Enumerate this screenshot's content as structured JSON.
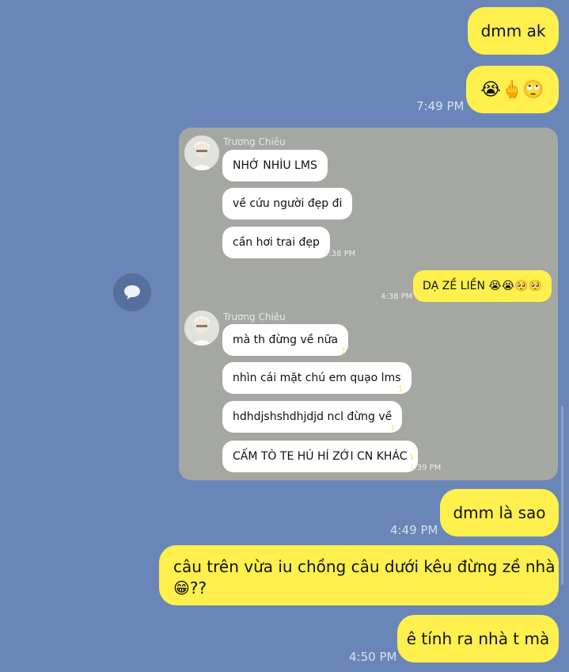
{
  "messages": {
    "m1": "dmm ak",
    "m2_emoji": "😭🖕🙄",
    "m2_time": "7:49 PM",
    "m3": "dmm là sao",
    "m3_time": "4:49 PM",
    "m4_line1": "câu trên vừa iu chồng câu dưới kêu đừng zề nhà",
    "m4_line2": "😁??",
    "m5": "ê tính ra nhà t mà",
    "m5_time": "4:50 PM"
  },
  "quoted": {
    "sender1": "Trương Chiêu",
    "g1": [
      "NHỚ NHÌU LMS",
      "về cứu người đẹp đi",
      "cần hơi trai đẹp"
    ],
    "g1_time": "4:38 PM",
    "own_text": "DẠ ZỀ LIỀN 😭😭🥺🥺",
    "own_time": "4:38 PM",
    "sender2": "Trương Chiêu",
    "g2": [
      "mà th đừng về nữa",
      "nhìn cái mặt chú em quạo lms",
      "hdhdjshshdhjdjd ncl đừng về",
      "CẤM TÒ TE HÚ HÍ ZỚI CN KHÁC"
    ],
    "unread": "1",
    "g2_time": "4:39 PM"
  },
  "icons": {
    "share": "share-chat-icon",
    "avatar": "avatar"
  },
  "colors": {
    "background": "#6a86b8",
    "bubble": "#fff04d",
    "quote_card": "#a4a7a2"
  }
}
